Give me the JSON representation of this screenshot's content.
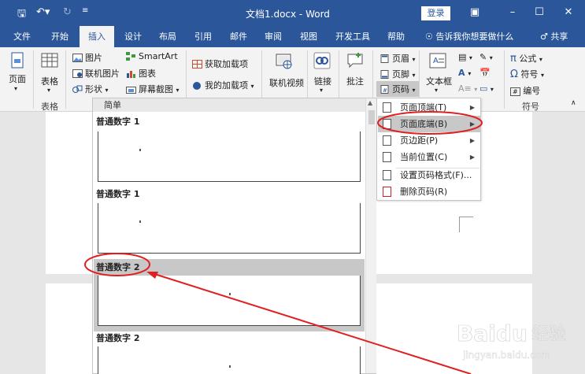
{
  "titlebar": {
    "title": "文档1.docx - Word",
    "login": "登录"
  },
  "tabs": [
    {
      "label": "文件"
    },
    {
      "label": "开始"
    },
    {
      "label": "插入"
    },
    {
      "label": "设计"
    },
    {
      "label": "布局"
    },
    {
      "label": "引用"
    },
    {
      "label": "邮件"
    },
    {
      "label": "审阅"
    },
    {
      "label": "视图"
    },
    {
      "label": "开发工具"
    },
    {
      "label": "帮助"
    }
  ],
  "tell_me": "告诉我你想要做什么",
  "share": "共享",
  "ribbon": {
    "page": "页面",
    "table": "表格",
    "table_group": "表格",
    "picture": "图片",
    "online_picture": "联机图片",
    "shapes": "形状",
    "smartart": "SmartArt",
    "chart": "图表",
    "screenshot": "屏幕截图",
    "get_addins": "获取加载项",
    "my_addins": "我的加载项",
    "online_video": "联机视频",
    "link": "链接",
    "comment": "批注",
    "header": "页眉",
    "footer": "页脚",
    "page_number": "页码",
    "textbox": "文本框",
    "equation": "公式",
    "symbol": "符号",
    "number": "编号",
    "symbol_group": "符号"
  },
  "gallery": {
    "section": "简单",
    "items": [
      {
        "label": "普通数字 1"
      },
      {
        "label": "普通数字 1"
      },
      {
        "label": "普通数字 2"
      },
      {
        "label": "普通数字 2"
      }
    ]
  },
  "menu": {
    "items": [
      {
        "label": "页面顶端(T)"
      },
      {
        "label": "页面底端(B)"
      },
      {
        "label": "页边距(P)"
      },
      {
        "label": "当前位置(C)"
      },
      {
        "label": "设置页码格式(F)..."
      },
      {
        "label": "删除页码(R)"
      }
    ]
  },
  "colors": {
    "accent": "#2b579a",
    "annotation": "#e02020"
  }
}
